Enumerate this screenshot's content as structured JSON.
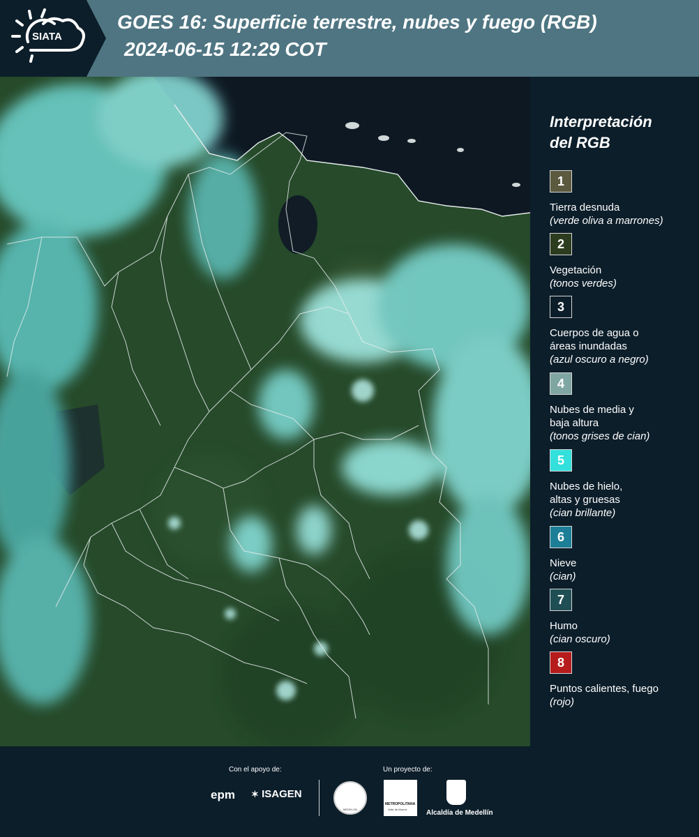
{
  "header": {
    "logo_text": "SIATA",
    "title_line1": "GOES 16: Superficie terrestre, nubes y fuego (RGB)",
    "title_line2": "2024-06-15 12:29 COT"
  },
  "legend": {
    "title": "Interpretación\ndel RGB",
    "items": [
      {
        "number": "1",
        "color": "#5b5a3f",
        "label": "Tierra desnuda",
        "note": "(verde oliva a marrones)"
      },
      {
        "number": "2",
        "color": "#2c3d1f",
        "label": "Vegetación",
        "note": "(tonos verdes)"
      },
      {
        "number": "3",
        "color": "#0c1e2a",
        "label": "Cuerpos de agua o\náreas inundadas",
        "note": "(azul oscuro a negro)"
      },
      {
        "number": "4",
        "color": "#7fa6a3",
        "label": "Nubes de media y\nbaja altura",
        "note": "(tonos grises de cian)"
      },
      {
        "number": "5",
        "color": "#33e0dc",
        "label": "Nubes de hielo,\naltas y gruesas",
        "note": "(cian brillante)"
      },
      {
        "number": "6",
        "color": "#1d7f97",
        "label": "Nieve",
        "note": "(cian)"
      },
      {
        "number": "7",
        "color": "#1f4f55",
        "label": "Humo",
        "note": "(cian oscuro)"
      },
      {
        "number": "8",
        "color": "#b71c1c",
        "label": "Puntos calientes, fuego",
        "note": "(rojo)"
      }
    ]
  },
  "footer": {
    "support_label": "Con el apoyo de:",
    "project_label": "Un proyecto de:",
    "sponsors": [
      "epm",
      "ISAGEN"
    ],
    "partners": [
      "METROPOLITANA",
      "Valle de Aburrá",
      "Alcaldía de Medellín",
      "MEDELLÍN"
    ]
  },
  "map": {
    "colors": {
      "ocean": "#0d1822",
      "vegetation": "#264a2a",
      "cloud": "#6fd6d2",
      "bright_cloud": "#a9f2ee",
      "border": "#e6ecec"
    }
  }
}
